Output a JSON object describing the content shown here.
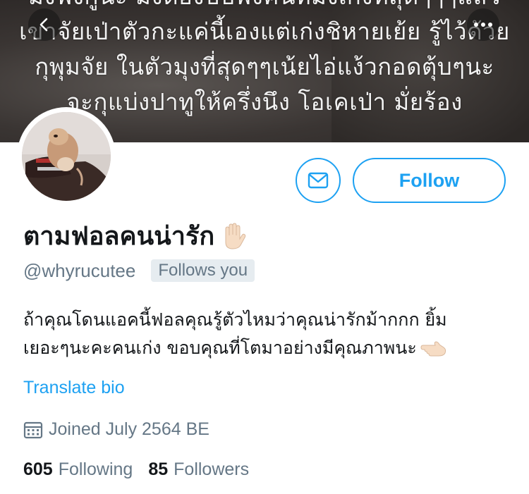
{
  "banner": {
    "lines": [
      "มึงฟังกูนะ มึงต้องปีปฟังคนที่มึงเก่งที่สุดๆๆๆแล้ว",
      "เขาจัยเป่าตัวกะแค่นี้เองแต่เก่งชิหายเย้ย รู้ไว้ด้วย",
      "กุพุมจัย ในตัวมุงที่สุดๆๆเน้ยไอ่แง้วกอดตุ้บๆนะ",
      "จะกุแบ่งปาทูให้ครึ่งนึง โอเคเป่า มั่ยร้อง"
    ]
  },
  "nav": {
    "back_icon": "chevron-left-icon",
    "more_icon": "more-horizontal-icon"
  },
  "profile": {
    "display_name": "ตามฟอลคนน่ารัก",
    "handle": "@whyrucutee",
    "follows_you": "Follows you",
    "bio_lines": [
      "ถ้าคุณโดนแอคนี้ฟอลคุณรู้ตัวไหมว่าคุณน่ารักม้ากกก ยิ้ม",
      "เยอะๆนะคะคนเก่ง ขอบคุณที่โตมาอย่างมีคุณภาพนะ"
    ],
    "translate_bio": "Translate bio",
    "joined": "Joined July 2564 BE",
    "following_count": "605",
    "following_label": "Following",
    "followers_count": "85",
    "followers_label": "Followers"
  },
  "actions": {
    "follow_label": "Follow",
    "message_icon": "envelope-icon"
  },
  "colors": {
    "accent": "#1da1f2",
    "text": "#14171a",
    "secondary": "#657786",
    "badge_bg": "#e6ecf0"
  }
}
